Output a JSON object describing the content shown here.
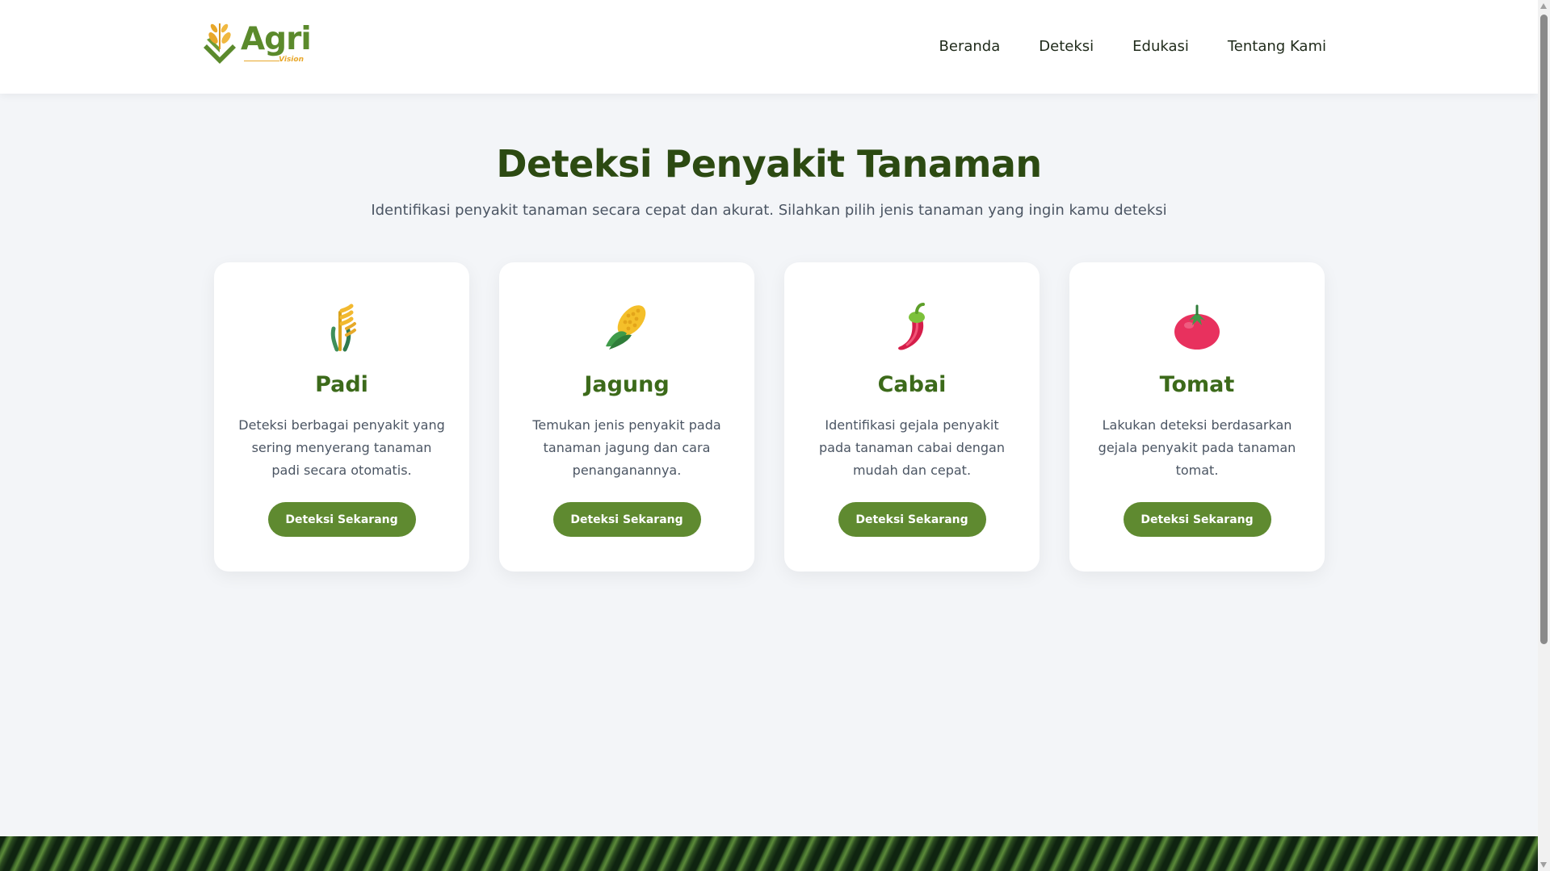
{
  "brand": {
    "name": "Agri",
    "sub": "Vision"
  },
  "nav": [
    {
      "label": "Beranda"
    },
    {
      "label": "Deteksi"
    },
    {
      "label": "Edukasi"
    },
    {
      "label": "Tentang Kami"
    }
  ],
  "hero": {
    "title": "Deteksi Penyakit Tanaman",
    "subtitle": "Identifikasi penyakit tanaman secara cepat dan akurat. Silahkan pilih jenis tanaman yang ingin kamu deteksi"
  },
  "cards": [
    {
      "title": "Padi",
      "icon": "rice-plant-icon",
      "description": "Deteksi berbagai penyakit yang sering menyerang tanaman padi secara otomatis.",
      "button": "Deteksi Sekarang"
    },
    {
      "title": "Jagung",
      "icon": "corn-icon",
      "description": "Temukan jenis penyakit pada tanaman jagung dan cara penanganannya.",
      "button": "Deteksi Sekarang"
    },
    {
      "title": "Cabai",
      "icon": "chili-pepper-icon",
      "description": "Identifikasi gejala penyakit pada tanaman cabai dengan mudah dan cepat.",
      "button": "Deteksi Sekarang"
    },
    {
      "title": "Tomat",
      "icon": "tomato-icon",
      "description": "Lakukan deteksi berdasarkan gejala penyakit pada tanaman tomat.",
      "button": "Deteksi Sekarang"
    }
  ],
  "colors": {
    "accent": "#5f8a30",
    "title": "#2c4a12",
    "card_title": "#3c6a1a",
    "background": "#f3f5f8"
  }
}
